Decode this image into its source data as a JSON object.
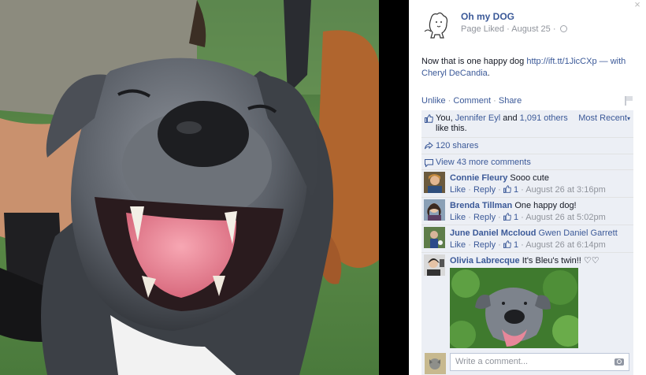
{
  "header": {
    "page_name": "Oh my DOG",
    "liked_label": "Page Liked",
    "date": "August 25",
    "dot": "·",
    "close_glyph": "×"
  },
  "post": {
    "text": "Now that is one happy dog",
    "link_text": "http://ift.tt/1JicCXp",
    "with_text": "— with",
    "tagged": "Cheryl DeCandia",
    "period": "."
  },
  "actions": {
    "unlike": "Unlike",
    "comment": "Comment",
    "share": "Share",
    "sep": "·"
  },
  "likes": {
    "you": "You,",
    "friend": "Jennifer Eyl",
    "and": "and",
    "others": "1,091 others",
    "tail": "like this.",
    "sort": "Most Recent",
    "sort_caret": "▾"
  },
  "shares": {
    "label": "120 shares"
  },
  "more_comments": {
    "label": "View 43 more comments"
  },
  "comments": [
    {
      "author": "Connie Fleury",
      "text": "Sooo cute",
      "like": "Like",
      "reply": "Reply",
      "likes": "1",
      "time": "August 26 at 3:16pm"
    },
    {
      "author": "Brenda Tillman",
      "text": "One happy dog!",
      "like": "Like",
      "reply": "Reply",
      "likes": "1",
      "time": "August 26 at 5:02pm"
    },
    {
      "author": "June Daniel Mccloud",
      "text": "Gwen Daniel Garrett",
      "like": "Like",
      "reply": "Reply",
      "likes": "1",
      "time": "August 26 at 6:14pm"
    },
    {
      "author": "Olivia Labrecque",
      "text": "It's Bleu's twin!! ♡♡"
    }
  ],
  "composer": {
    "placeholder": "Write a comment..."
  },
  "colors": {
    "link": "#3b5998",
    "panel": "#eceff5",
    "muted": "#90949c"
  },
  "icons": [
    "close-icon",
    "globe-icon",
    "flag-icon",
    "thumbs-up-icon",
    "share-arrow-icon",
    "comment-bubble-icon",
    "camera-icon"
  ]
}
